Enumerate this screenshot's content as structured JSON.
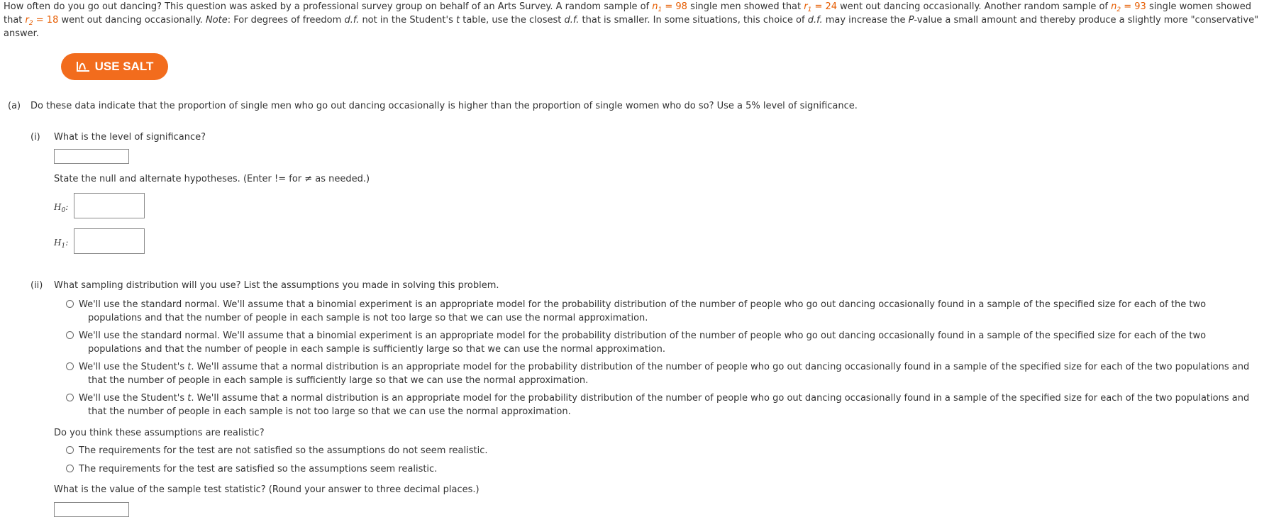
{
  "intro": {
    "t1": "How often do you go out dancing? This question was asked by a professional survey group on behalf of an Arts Survey. A random sample of ",
    "n1_var": "n",
    "n1_sub": "1",
    "n1_eq": " = 98",
    "t2": " single men showed that ",
    "r1_var": "r",
    "r1_sub": "1",
    "r1_eq": " = 24",
    "t3": " went out dancing occasionally. Another random sample of ",
    "n2_var": "n",
    "n2_sub": "2",
    "n2_eq": " = 93",
    "t4": " single women showed that ",
    "r2_var": "r",
    "r2_sub": "2",
    "r2_eq": " = 18",
    "t5": " went out dancing occasionally. ",
    "note": "Note",
    "t6": ": For degrees of freedom ",
    "df1": "d.f.",
    "t7": " not in the Student's ",
    "t_var": "t",
    "t8": " table, use the closest ",
    "df2": "d.f.",
    "t9": " that is smaller. In some situations, this choice of ",
    "df3": "d.f.",
    "t10": " may increase the ",
    "p_var": "P",
    "t11": "-value a small amount and thereby produce a slightly more \"conservative\" answer."
  },
  "salt_button": {
    "label": "USE SALT",
    "color": "#f26c1d"
  },
  "part_a": {
    "marker": "(a)",
    "question": "Do these data indicate that the proportion of single men who go out dancing occasionally is higher than the proportion of single women who do so? Use a 5% level of significance."
  },
  "part_i": {
    "marker": "(i)",
    "question": "What is the level of significance?",
    "hyp_prompt": "State the null and alternate hypotheses. (Enter != for ≠ as needed.)",
    "h0_var": "H",
    "h0_sub": "0",
    "h1_var": "H",
    "h1_sub": "1",
    "colon": ":"
  },
  "part_ii": {
    "marker": "(ii)",
    "question": "What sampling distribution will you use? List the assumptions you made in solving this problem.",
    "options": [
      {
        "line1": "We'll use the standard normal. We'll assume that a binomial experiment is an appropriate model for the probability distribution of the number of people who go out dancing occasionally found in a sample of the specified size for each of the two",
        "line2": "populations and that the number of people in each sample is not too large so that we can use the normal approximation."
      },
      {
        "line1": "We'll use the standard normal. We'll assume that a binomial experiment is an appropriate model for the probability distribution of the number of people who go out dancing occasionally found in a sample of the specified size for each of the two",
        "line2": "populations and that the number of people in each sample is sufficiently large so that we can use the normal approximation."
      },
      {
        "line1a": "We'll use the Student's ",
        "line1t": "t",
        "line1b": ". We'll assume that a normal distribution is an appropriate model for the probability distribution of the number of people who go out dancing occasionally found in a sample of the specified size for each of the two populations and",
        "line2": "that the number of people in each sample is sufficiently large so that we can use the normal approximation."
      },
      {
        "line1a": "We'll use the Student's ",
        "line1t": "t",
        "line1b": ". We'll assume that a normal distribution is an appropriate model for the probability distribution of the number of people who go out dancing occasionally found in a sample of the specified size for each of the two populations and",
        "line2": "that the number of people in each sample is not too large so that we can use the normal approximation."
      }
    ],
    "realistic_question": "Do you think these assumptions are realistic?",
    "realistic_options": [
      "The requirements for the test are not satisfied so the assumptions do not seem realistic.",
      "The requirements for the test are satisfied so the assumptions seem realistic."
    ],
    "stat_question": "What is the value of the sample test statistic? (Round your answer to three decimal places.)"
  }
}
